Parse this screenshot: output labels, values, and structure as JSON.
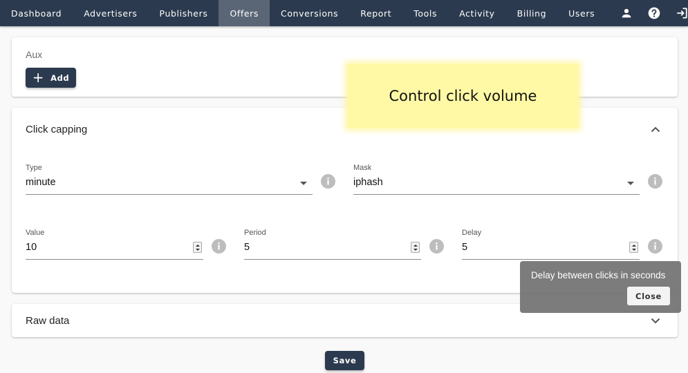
{
  "nav": {
    "items": [
      {
        "label": "Dashboard",
        "active": false
      },
      {
        "label": "Advertisers",
        "active": false
      },
      {
        "label": "Publishers",
        "active": false
      },
      {
        "label": "Offers",
        "active": true
      },
      {
        "label": "Conversions",
        "active": false
      },
      {
        "label": "Report",
        "active": false
      },
      {
        "label": "Tools",
        "active": false
      },
      {
        "label": "Activity",
        "active": false
      },
      {
        "label": "Billing",
        "active": false
      },
      {
        "label": "Users",
        "active": false
      }
    ],
    "icons": [
      "person-icon",
      "help-icon",
      "logout-icon"
    ],
    "colors": {
      "bar": "#2b3a4e",
      "active": "#5a6676"
    }
  },
  "aux": {
    "title": "Aux",
    "add_label": "Add"
  },
  "capping": {
    "title": "Click capping",
    "expanded": true,
    "type": {
      "label": "Type",
      "value": "minute"
    },
    "mask": {
      "label": "Mask",
      "value": "iphash"
    },
    "value": {
      "label": "Value",
      "value": "10"
    },
    "period": {
      "label": "Period",
      "value": "5"
    },
    "delay": {
      "label": "Delay",
      "value": "5"
    }
  },
  "raw": {
    "title": "Raw data",
    "expanded": false
  },
  "save_label": "Save",
  "tooltip": {
    "text": "Delay between clicks in seconds",
    "close_label": "Close"
  },
  "callout": {
    "text": "Control click volume",
    "color": "#fff9a6"
  }
}
